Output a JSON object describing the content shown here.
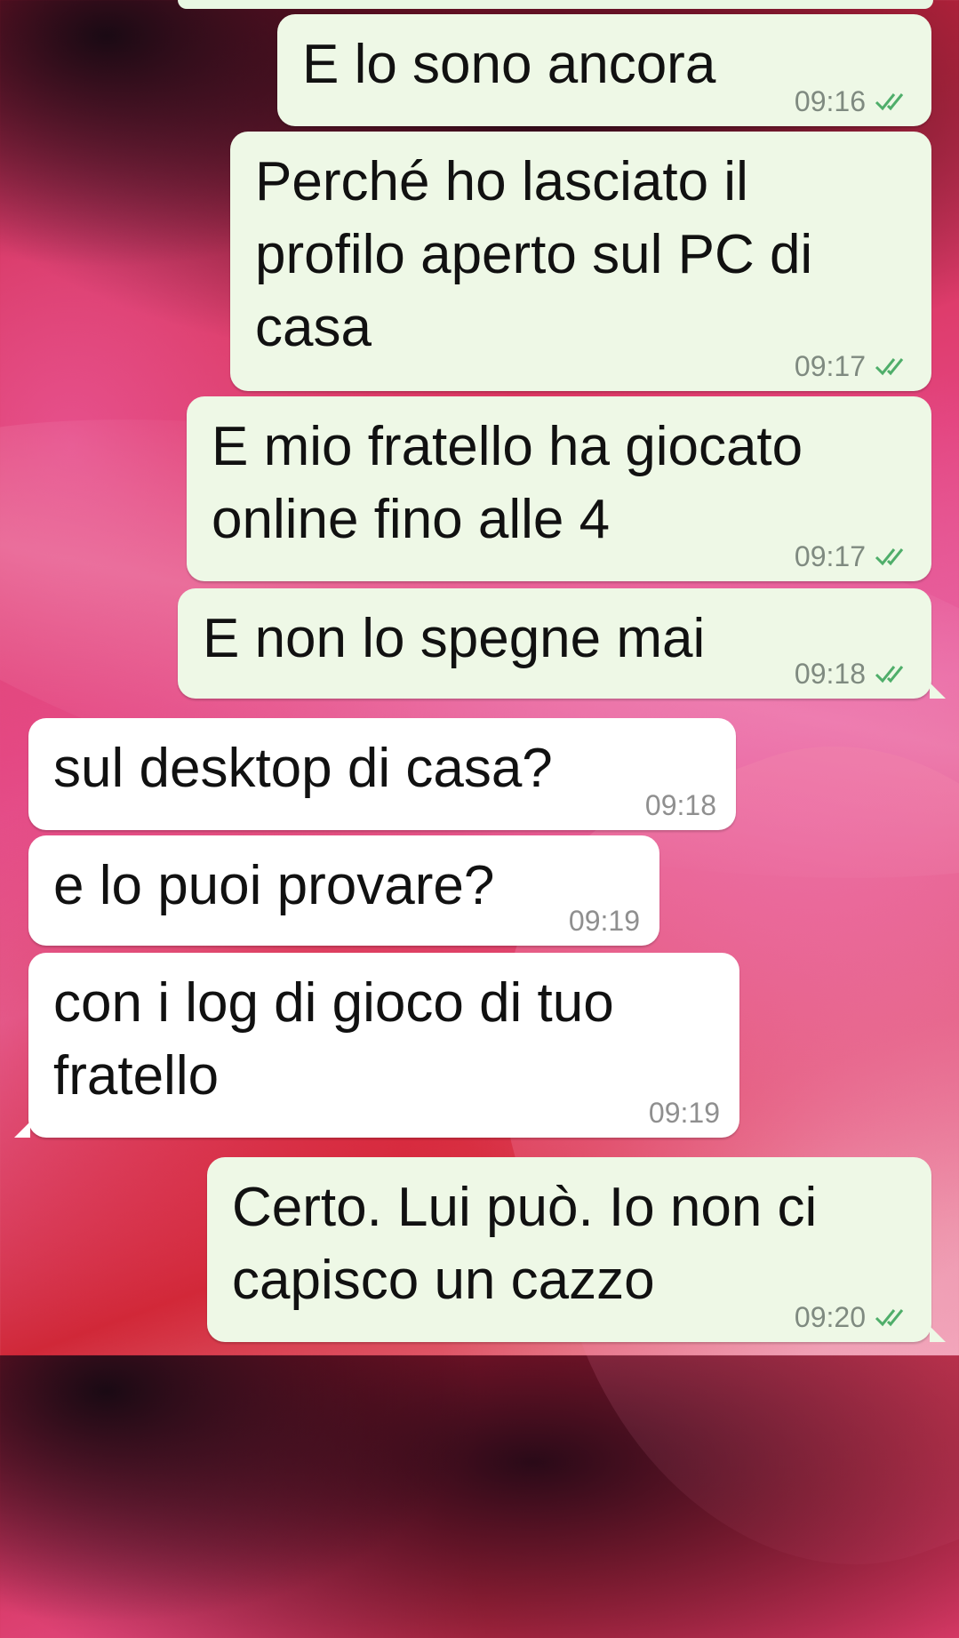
{
  "messages": [
    {
      "direction": "out",
      "text": "E lo sono ancora",
      "time": "09:16",
      "status": "double-check-icon"
    },
    {
      "direction": "out",
      "text": "Perché ho lasciato il\nprofilo aperto sul PC di\ncasa",
      "time": "09:17",
      "status": "double-check-icon"
    },
    {
      "direction": "out",
      "text": "E mio fratello ha giocato\nonline fino alle 4",
      "time": "09:17",
      "status": "double-check-icon"
    },
    {
      "direction": "out",
      "text": "E non lo spegne mai",
      "time": "09:18",
      "status": "double-check-icon"
    },
    {
      "direction": "in",
      "text": "sul desktop di casa?",
      "time": "09:18"
    },
    {
      "direction": "in",
      "text": "e lo puoi provare?",
      "time": "09:19"
    },
    {
      "direction": "in",
      "text": "con i log di gioco di tuo\nfratello",
      "time": "09:19"
    },
    {
      "direction": "out",
      "text": "Certo. Lui può. Io non ci\ncapisco un cazzo",
      "time": "09:20",
      "status": "double-check-icon"
    }
  ],
  "colors": {
    "outgoing_bubble": "#eef8e6",
    "incoming_bubble": "#ffffff",
    "tick": "#4fae6a"
  }
}
